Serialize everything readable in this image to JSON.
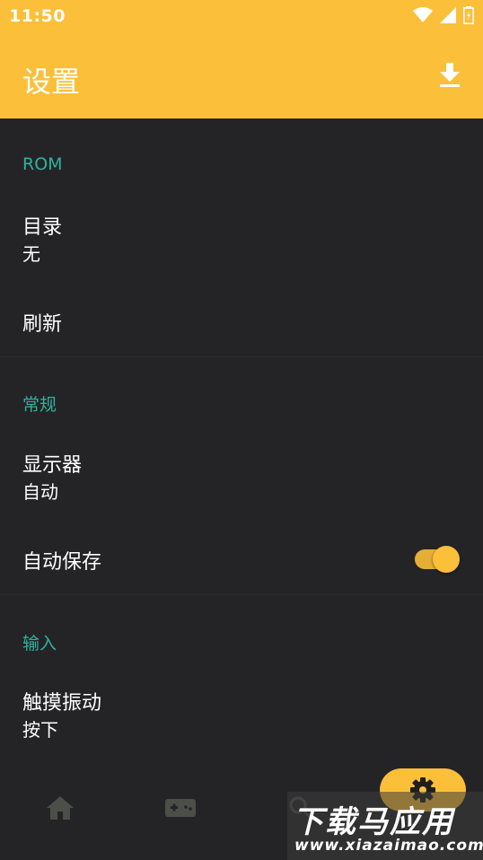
{
  "status_bar": {
    "time": "11:50"
  },
  "app_bar": {
    "title": "设置"
  },
  "sections": {
    "rom": {
      "header": "ROM",
      "directory": {
        "title": "目录",
        "summary": "无"
      },
      "refresh": {
        "title": "刷新"
      }
    },
    "general": {
      "header": "常规",
      "display": {
        "title": "显示器",
        "summary": "自动"
      },
      "autosave": {
        "title": "自动保存",
        "enabled": true
      }
    },
    "input": {
      "header": "输入",
      "haptic": {
        "title": "触摸振动",
        "summary": "按下"
      }
    }
  },
  "bottom_nav": {
    "items": [
      "home-icon",
      "gamepad-icon",
      "search-icon",
      "settings-icon"
    ]
  },
  "watermark": {
    "title": "下载马应用",
    "url": "www.xiazaimao.com"
  },
  "colors": {
    "accent": "#fbbf3a",
    "section": "#2fb39a",
    "background": "#242427"
  }
}
